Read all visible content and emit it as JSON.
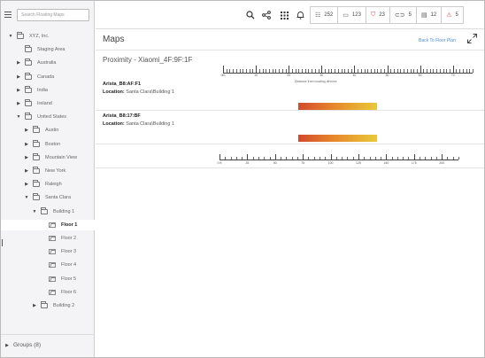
{
  "sidebar": {
    "search_placeholder": "Search Floating Maps",
    "tree": [
      {
        "label": "XYZ, Inc.",
        "depth": 0,
        "expanded": true,
        "type": "folder"
      },
      {
        "label": "Staging Area",
        "depth": 1,
        "expanded": null,
        "type": "folder"
      },
      {
        "label": "Australia",
        "depth": 1,
        "expanded": false,
        "type": "folder"
      },
      {
        "label": "Canada",
        "depth": 1,
        "expanded": false,
        "type": "folder"
      },
      {
        "label": "India",
        "depth": 1,
        "expanded": false,
        "type": "folder"
      },
      {
        "label": "Ireland",
        "depth": 1,
        "expanded": false,
        "type": "folder"
      },
      {
        "label": "United States",
        "depth": 1,
        "expanded": true,
        "type": "folder"
      },
      {
        "label": "Austin",
        "depth": 2,
        "expanded": false,
        "type": "folder"
      },
      {
        "label": "Boston",
        "depth": 2,
        "expanded": false,
        "type": "folder"
      },
      {
        "label": "Mountain View",
        "depth": 2,
        "expanded": false,
        "type": "folder"
      },
      {
        "label": "New York",
        "depth": 2,
        "expanded": false,
        "type": "folder"
      },
      {
        "label": "Raleigh",
        "depth": 2,
        "expanded": false,
        "type": "folder"
      },
      {
        "label": "Santa Clara",
        "depth": 2,
        "expanded": true,
        "type": "folder"
      },
      {
        "label": "Building 1",
        "depth": 3,
        "expanded": true,
        "type": "folder"
      },
      {
        "label": "Floor 1",
        "depth": 4,
        "expanded": null,
        "type": "floor",
        "selected": true
      },
      {
        "label": "Floor 2",
        "depth": 4,
        "expanded": null,
        "type": "floor"
      },
      {
        "label": "Floor 3",
        "depth": 4,
        "expanded": null,
        "type": "floor"
      },
      {
        "label": "Floor 4",
        "depth": 4,
        "expanded": null,
        "type": "floor"
      },
      {
        "label": "Floor 5",
        "depth": 4,
        "expanded": null,
        "type": "floor"
      },
      {
        "label": "Floor 6",
        "depth": 4,
        "expanded": null,
        "type": "floor"
      },
      {
        "label": "Building 2",
        "depth": 3,
        "expanded": false,
        "type": "folder"
      }
    ],
    "groups_label": "Groups",
    "groups_count": "(8)"
  },
  "topbar": {
    "icons": [
      "search-icon",
      "share-icon",
      "apps-grid-icon",
      "notification-bell-icon"
    ],
    "stats": [
      {
        "icon": "devices-icon",
        "value": "252"
      },
      {
        "icon": "monitor-icon",
        "value": "123"
      },
      {
        "icon": "shield-icon",
        "value": "23",
        "color": "#d9534f"
      },
      {
        "icon": "link-icon",
        "value": "5"
      },
      {
        "icon": "server-icon",
        "value": "12"
      },
      {
        "icon": "warning-icon",
        "value": "5",
        "color": "#d9534f"
      }
    ]
  },
  "main": {
    "title": "Maps",
    "back_link": "Back To Floor Plan",
    "proximity_title": "Proximity - Xiaomi_4F:9F:1F",
    "ruler_top": {
      "labels": [
        "0m",
        "10",
        "20",
        "30",
        "40",
        "50",
        "60",
        "70"
      ],
      "caption": "Distance from locating devices"
    },
    "devices": [
      {
        "name": "Arista_B8:AF:F1",
        "location_label": "Location:",
        "location": "Santa Clara\\Building 1",
        "range_start": 23,
        "range_end": 47
      },
      {
        "name": "Arista_B8:17:BF",
        "location_label": "Location:",
        "location": "Santa Clara\\Building 1",
        "range_start": 23,
        "range_end": 47
      }
    ],
    "ruler_bottom": {
      "labels": [
        "0 ft",
        "25",
        "50",
        "75",
        "100",
        "125",
        "150",
        "175",
        "200"
      ]
    }
  }
}
